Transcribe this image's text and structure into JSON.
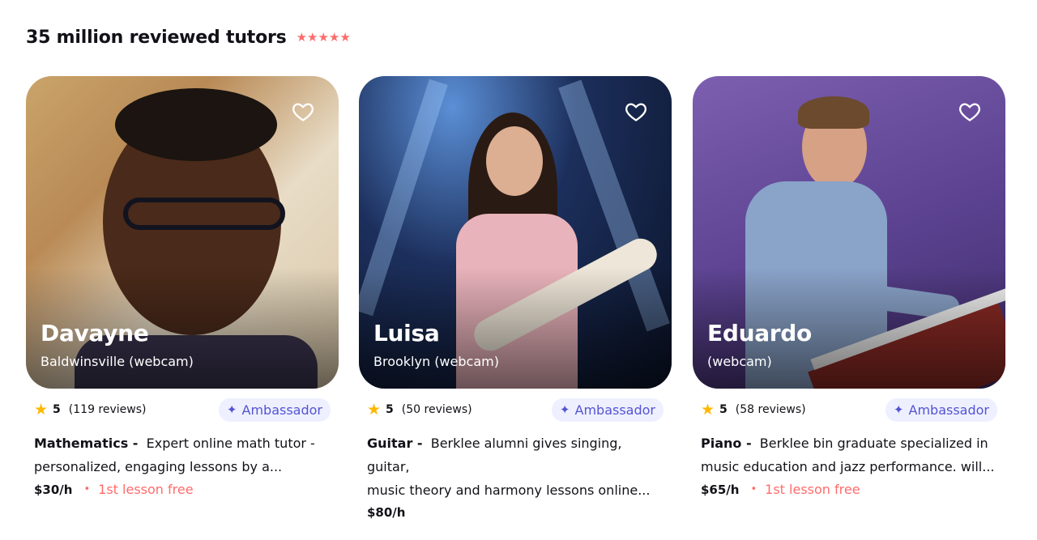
{
  "header": {
    "title": "35 million reviewed tutors",
    "stars": "★★★★★"
  },
  "tutors": [
    {
      "name": "Davayne",
      "location": "Baldwinsville (webcam)",
      "score": "5",
      "reviews": "(119 reviews)",
      "badge": "Ambassador",
      "subject": "Mathematics -",
      "description_line1": "Expert online math tutor -",
      "description_line2": "personalized, engaging lessons by a...",
      "price": "$30/h",
      "free_lesson_ord": "1st",
      "free_lesson_text": "lesson free"
    },
    {
      "name": "Luisa",
      "location": "Brooklyn (webcam)",
      "score": "5",
      "reviews": "(50 reviews)",
      "badge": "Ambassador",
      "subject": "Guitar -",
      "description_line1": "Berklee alumni gives singing, guitar,",
      "description_line2": "music theory and harmony lessons online...",
      "price": "$80/h"
    },
    {
      "name": "Eduardo",
      "location": "(webcam)",
      "score": "5",
      "reviews": "(58 reviews)",
      "badge": "Ambassador",
      "subject": "Piano -",
      "description_line1": "Berklee bin graduate specialized in",
      "description_line2": "music education and jazz performance. will...",
      "price": "$65/h",
      "free_lesson_ord": "1st",
      "free_lesson_text": "lesson free"
    }
  ],
  "icons": {
    "favorite": "heart-icon",
    "rating": "star-icon",
    "badge": "sparkle-icon"
  },
  "colors": {
    "accent": "#ff6b6b",
    "badge_bg": "#eef0ff",
    "badge_text": "#5454d4",
    "star": "#ffb800"
  }
}
